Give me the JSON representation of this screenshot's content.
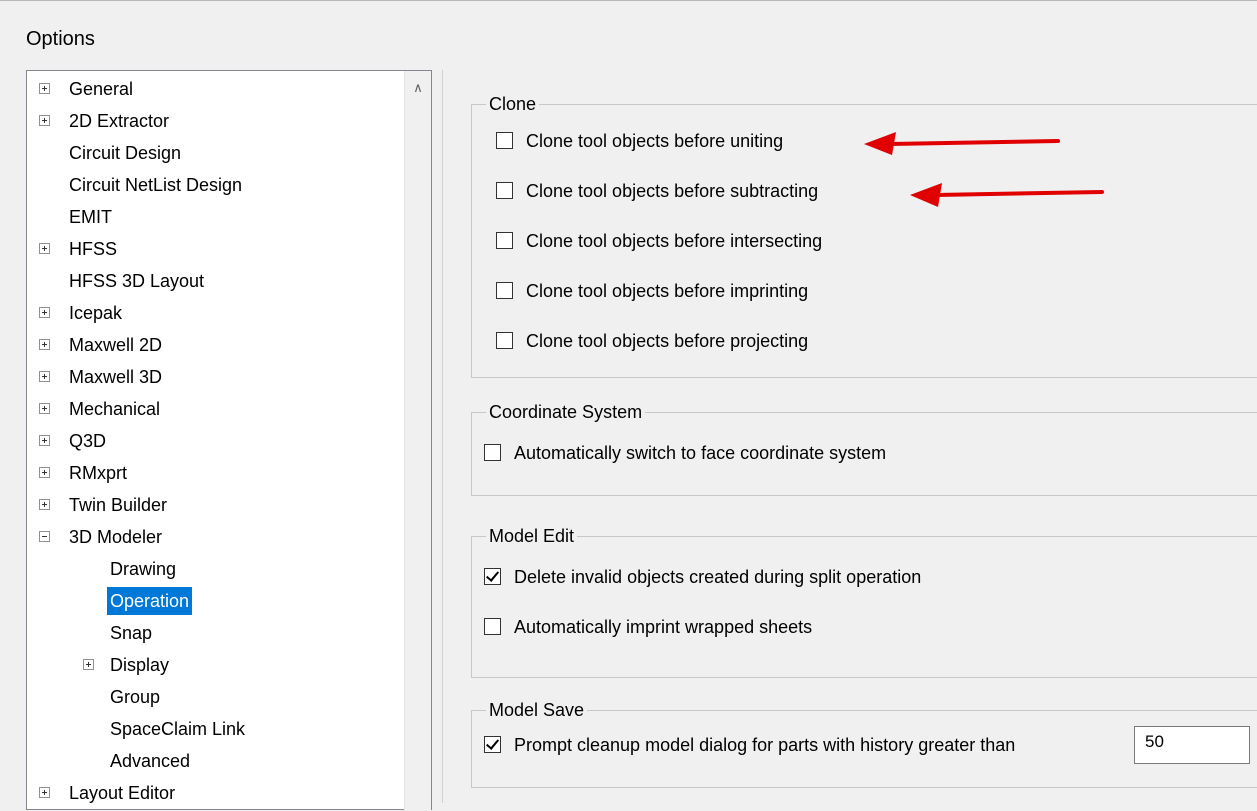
{
  "window": {
    "title": "Options"
  },
  "tree": {
    "items": [
      {
        "label": "General",
        "expander": "plus",
        "level": 0
      },
      {
        "label": "2D Extractor",
        "expander": "plus",
        "level": 0
      },
      {
        "label": "Circuit Design",
        "expander": "none",
        "level": 0
      },
      {
        "label": "Circuit NetList Design",
        "expander": "none",
        "level": 0
      },
      {
        "label": "EMIT",
        "expander": "none",
        "level": 0
      },
      {
        "label": "HFSS",
        "expander": "plus",
        "level": 0
      },
      {
        "label": "HFSS 3D Layout",
        "expander": "none",
        "level": 0
      },
      {
        "label": "Icepak",
        "expander": "plus",
        "level": 0
      },
      {
        "label": "Maxwell 2D",
        "expander": "plus",
        "level": 0
      },
      {
        "label": "Maxwell 3D",
        "expander": "plus",
        "level": 0
      },
      {
        "label": "Mechanical",
        "expander": "plus",
        "level": 0
      },
      {
        "label": "Q3D",
        "expander": "plus",
        "level": 0
      },
      {
        "label": "RMxprt",
        "expander": "plus",
        "level": 0
      },
      {
        "label": "Twin Builder",
        "expander": "plus",
        "level": 0
      },
      {
        "label": "3D Modeler",
        "expander": "minus",
        "level": 0
      },
      {
        "label": "Drawing",
        "expander": "none",
        "level": 1
      },
      {
        "label": "Operation",
        "expander": "none",
        "level": 1,
        "selected": true
      },
      {
        "label": "Snap",
        "expander": "none",
        "level": 1
      },
      {
        "label": "Display",
        "expander": "plus",
        "level": 1
      },
      {
        "label": "Group",
        "expander": "none",
        "level": 1
      },
      {
        "label": "SpaceClaim Link",
        "expander": "none",
        "level": 1
      },
      {
        "label": "Advanced",
        "expander": "none",
        "level": 1
      },
      {
        "label": "Layout Editor",
        "expander": "plus",
        "level": 0
      }
    ],
    "scroll_up_icon": "chevron-up-icon"
  },
  "clone": {
    "title": "Clone",
    "options": [
      {
        "label": "Clone tool objects before uniting",
        "checked": false
      },
      {
        "label": "Clone tool objects before subtracting",
        "checked": false
      },
      {
        "label": "Clone tool objects before intersecting",
        "checked": false
      },
      {
        "label": "Clone tool objects before imprinting",
        "checked": false
      },
      {
        "label": "Clone tool objects before projecting",
        "checked": false
      }
    ]
  },
  "coordinate_system": {
    "title": "Coordinate System",
    "options": [
      {
        "label": "Automatically switch to face coordinate system",
        "checked": false
      }
    ]
  },
  "model_edit": {
    "title": "Model Edit",
    "options": [
      {
        "label": "Delete invalid objects created during split operation",
        "checked": true
      },
      {
        "label": "Automatically imprint wrapped sheets",
        "checked": false
      }
    ]
  },
  "model_save": {
    "title": "Model Save",
    "options": [
      {
        "label": "Prompt cleanup model dialog for parts with history greater than",
        "checked": true
      }
    ],
    "history_value": "50"
  },
  "annotations": {
    "arrow_color": "#e00000"
  }
}
